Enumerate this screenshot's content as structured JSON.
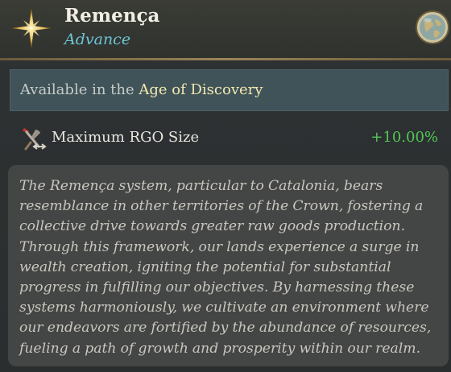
{
  "header": {
    "title": "Remença",
    "subtitle": "Advance",
    "icon": "compass-star-icon",
    "badge_icon": "globe-icon"
  },
  "availability": {
    "prefix": "Available in the",
    "age": "Age of Discovery"
  },
  "modifier": {
    "icon": "rgo-tools-icon",
    "label": "Maximum RGO Size",
    "value": "+10.00%",
    "value_color": "#52c755"
  },
  "description": "The Remença system, particular to Catalonia, bears resemblance in other territories of the Crown, fostering a collective drive towards greater raw goods production. Through this framework, our lands experience a surge in wealth creation, igniting the potential for substantial progress in fulfilling our objectives. By harnessing these systems harmoniously, we cultivate an environment where our endeavors are fortified by the abundance of resources, fueling a path of growth and prosperity within our realm.",
  "colors": {
    "title": "#f1eee4",
    "subtitle": "#6ec4d6",
    "age_highlight": "#f3e9b0",
    "positive": "#52c755"
  }
}
